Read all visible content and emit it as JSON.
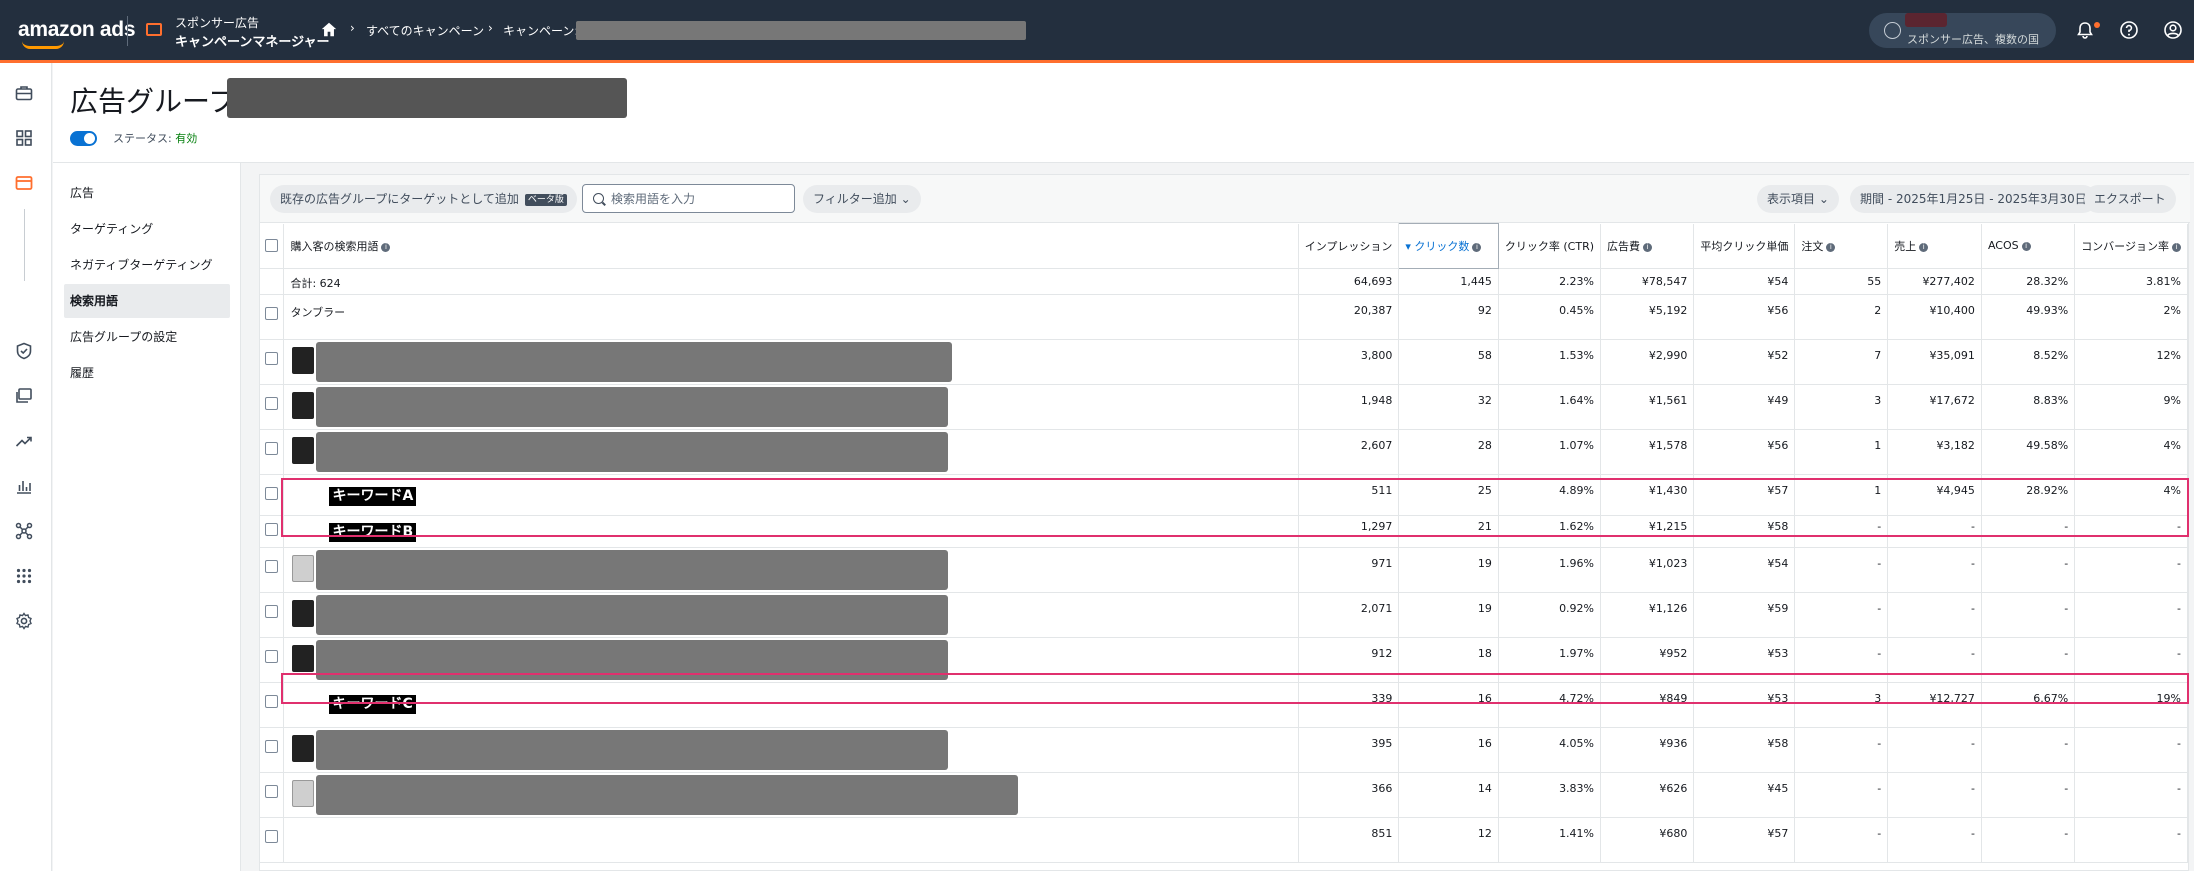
{
  "topbar": {
    "logo": "amazon ads",
    "product_line1": "スポンサー広告",
    "product_line2": "キャンペーンマネージャー",
    "breadcrumb_all": "すべてのキャンペーン",
    "breadcrumb_campaign": "キャンペーン:",
    "region_label": "スポンサー広告、複数の国"
  },
  "header": {
    "title": "広告グループ:",
    "status_label": "ステータス:",
    "status_value": "有効"
  },
  "subnav": {
    "items": [
      "広告",
      "ターゲティング",
      "ネガティブターゲティング",
      "検索用語",
      "広告グループの設定",
      "履歴"
    ],
    "active_index": 3
  },
  "toolbar": {
    "add_target_label": "既存の広告グループにターゲットとして追加",
    "beta_badge": "ベータ版",
    "search_placeholder": "検索用語を入力",
    "filter_label": "フィルター追加",
    "columns_label": "表示項目",
    "date_range_label": "期間 - 2025年1月25日 - 2025年3月30日",
    "export_label": "エクスポート"
  },
  "table": {
    "columns": [
      "購入客の検索用語",
      "インプレッション",
      "クリック数",
      "クリック率 (CTR)",
      "広告費",
      "平均クリック単価",
      "注文",
      "売上",
      "ACOS",
      "コンバージョン率"
    ],
    "sorted_column": "クリック数",
    "total": {
      "label": "合計: 624",
      "values": [
        "64,693",
        "1,445",
        "2.23%",
        "¥78,547",
        "¥54",
        "55",
        "¥277,402",
        "28.32%",
        "3.81%"
      ]
    },
    "rows": [
      {
        "term": "タンブラー",
        "values": [
          "20,387",
          "92",
          "0.45%",
          "¥5,192",
          "¥56",
          "2",
          "¥10,400",
          "49.93%",
          "2%"
        ]
      },
      {
        "term": "",
        "values": [
          "3,800",
          "58",
          "1.53%",
          "¥2,990",
          "¥52",
          "7",
          "¥35,091",
          "8.52%",
          "12%"
        ]
      },
      {
        "term": "",
        "values": [
          "1,948",
          "32",
          "1.64%",
          "¥1,561",
          "¥49",
          "3",
          "¥17,672",
          "8.83%",
          "9%"
        ]
      },
      {
        "term": "",
        "values": [
          "2,607",
          "28",
          "1.07%",
          "¥1,578",
          "¥56",
          "1",
          "¥3,182",
          "49.58%",
          "4%"
        ]
      },
      {
        "term": "キーワードA",
        "values": [
          "511",
          "25",
          "4.89%",
          "¥1,430",
          "¥57",
          "1",
          "¥4,945",
          "28.92%",
          "4%"
        ]
      },
      {
        "term": "キーワードB",
        "values": [
          "1,297",
          "21",
          "1.62%",
          "¥1,215",
          "¥58",
          "-",
          "-",
          "-",
          "-"
        ]
      },
      {
        "term": "",
        "values": [
          "971",
          "19",
          "1.96%",
          "¥1,023",
          "¥54",
          "-",
          "-",
          "-",
          "-"
        ]
      },
      {
        "term": "",
        "values": [
          "2,071",
          "19",
          "0.92%",
          "¥1,126",
          "¥59",
          "-",
          "-",
          "-",
          "-"
        ]
      },
      {
        "term": "",
        "values": [
          "912",
          "18",
          "1.97%",
          "¥952",
          "¥53",
          "-",
          "-",
          "-",
          "-"
        ]
      },
      {
        "term": "キーワードC",
        "values": [
          "339",
          "16",
          "4.72%",
          "¥849",
          "¥53",
          "3",
          "¥12,727",
          "6.67%",
          "19%"
        ]
      },
      {
        "term": "",
        "values": [
          "395",
          "16",
          "4.05%",
          "¥936",
          "¥58",
          "-",
          "-",
          "-",
          "-"
        ]
      },
      {
        "term": "",
        "values": [
          "366",
          "14",
          "3.83%",
          "¥626",
          "¥45",
          "-",
          "-",
          "-",
          "-"
        ]
      },
      {
        "term": "",
        "values": [
          "851",
          "12",
          "1.41%",
          "¥680",
          "¥57",
          "-",
          "-",
          "-",
          "-"
        ]
      }
    ]
  },
  "colors": {
    "topbar": "#232f3e",
    "accent": "#ff6f2e",
    "highlight": "#e0306e",
    "link": "#0972d3",
    "status_green": "#037f0c"
  }
}
